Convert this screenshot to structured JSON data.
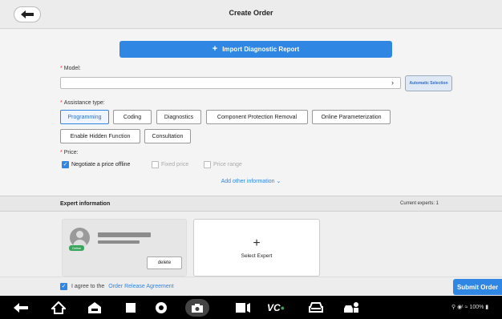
{
  "header": {
    "title": "Create Order"
  },
  "import_button": {
    "label": "Import Diagnostic Report"
  },
  "model": {
    "label": "Model:",
    "required_mark": "*",
    "value": "",
    "auto_selection_label": "Automatic Selection"
  },
  "assistance": {
    "label": "Assistance type:",
    "required_mark": "*",
    "options": [
      {
        "label": "Programming",
        "selected": true
      },
      {
        "label": "Coding",
        "selected": false
      },
      {
        "label": "Diagnostics",
        "selected": false
      },
      {
        "label": "Component Protection Removal",
        "selected": false
      },
      {
        "label": "Online Parameterization",
        "selected": false
      },
      {
        "label": "Enable Hidden Function",
        "selected": false
      },
      {
        "label": "Consultation",
        "selected": false
      }
    ]
  },
  "price": {
    "label": "Price:",
    "required_mark": "*",
    "options": [
      {
        "label": "Negotiate a price offline",
        "checked": true
      },
      {
        "label": "Fixed price",
        "checked": false
      },
      {
        "label": "Price range",
        "checked": false
      }
    ]
  },
  "add_info": {
    "label": "Add other information"
  },
  "expert": {
    "title": "Expert information",
    "current_label": "Current experts: 1",
    "card": {
      "status_badge": "Online",
      "delete_label": "delete"
    },
    "select_label": "Select Expert"
  },
  "footer": {
    "agree_prefix": "I agree to the",
    "agree_link": "Order Release Agreement",
    "agreed": true,
    "submit_label": "Submit Order"
  },
  "navbar": {
    "icons": [
      "back-icon",
      "home-icon",
      "car-home-icon",
      "recent-apps-icon",
      "browser-icon",
      "camera-icon",
      "screen-mirror-icon",
      "vci-icon",
      "vehicle-icon",
      "car-service-icon"
    ],
    "status_text": "100%"
  },
  "colors": {
    "accent": "#2f86e3",
    "online": "#3aa65b",
    "required": "#ee3333"
  }
}
